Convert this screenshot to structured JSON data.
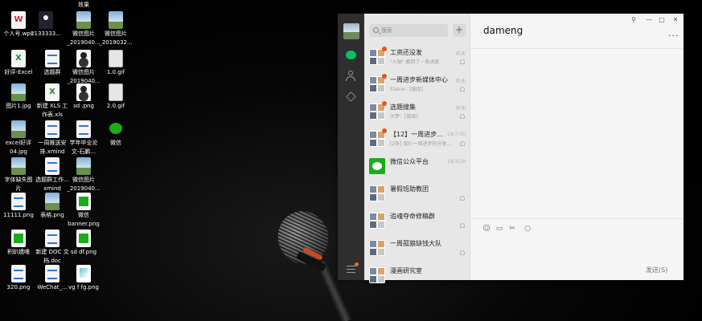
{
  "desktop": {
    "icons": [
      {
        "label": "个人号.wps"
      },
      {
        "label": "2133333..."
      },
      {
        "label": "效果"
      },
      {
        "label": "微信图片"
      },
      {
        "label": "_2019040..."
      },
      {
        "label": "微信图片"
      },
      {
        "label": "_2019032..."
      },
      {
        "label": "好评-Excel"
      },
      {
        "label": "选题群"
      },
      {
        "label": "微信图片"
      },
      {
        "label": "_2019040..."
      },
      {
        "label": "1.0.gif"
      },
      {
        "label": "图片1.jpg"
      },
      {
        "label": "新建 XLS 工"
      },
      {
        "label": "作表.xls"
      },
      {
        "label": "sd .png"
      },
      {
        "label": "2.0.gif"
      },
      {
        "label": "excel好评"
      },
      {
        "label": "04.jpg"
      },
      {
        "label": "一周推送安"
      },
      {
        "label": "排.xmind"
      },
      {
        "label": "学年毕业论"
      },
      {
        "label": "文-石鹏..."
      },
      {
        "label": "微信"
      },
      {
        "label": "字体缺失图"
      },
      {
        "label": "片"
      },
      {
        "label": "选题群工作..."
      },
      {
        "label": "xmind"
      },
      {
        "label": "微信图片"
      },
      {
        "label": "_2019040..."
      },
      {
        "label": "11111.png"
      },
      {
        "label": "表格.png"
      },
      {
        "label": "微信"
      },
      {
        "label": "banner.png"
      },
      {
        "label": "积趴嫱嗜"
      },
      {
        "label": "新建 DOC 文"
      },
      {
        "label": "档.doc"
      },
      {
        "label": "sd df.png"
      },
      {
        "label": "320.png"
      },
      {
        "label": "WeChat_..."
      },
      {
        "label": "vg f fg.png"
      }
    ]
  },
  "wechat": {
    "search": {
      "placeholder": "搜索"
    },
    "add_label": "+",
    "chats": [
      {
        "name": "工资还没发",
        "preview": "\"火锅\" 撤回了一条消息",
        "time": "昨天",
        "unread": true
      },
      {
        "name": "一周进步新媒体中心",
        "preview": "Elaine：[链接]",
        "time": "昨天",
        "unread": true
      },
      {
        "name": "选题搜集",
        "preview": "大梦：[链接]",
        "time": "昨天",
        "unread": true
      },
      {
        "name": "【12】一周进步...",
        "preview": "[2条] 我们一周进步的分享...",
        "time": "19/7/30",
        "unread": true
      },
      {
        "name": "微信公众平台",
        "preview": "",
        "time": "19/3/29",
        "unread": false,
        "official": true
      },
      {
        "name": "暑假班助教团",
        "preview": "",
        "time": "",
        "unread": false
      },
      {
        "name": "追魂夺命修稿群",
        "preview": "",
        "time": "",
        "unread": false
      },
      {
        "name": "一周孤狼缺钱大队",
        "preview": "",
        "time": "",
        "unread": false
      },
      {
        "name": "漫画研究室",
        "preview": "",
        "time": "",
        "unread": false
      }
    ],
    "chat": {
      "title": "dameng",
      "more_label": "...",
      "send_label": "发送(S)"
    },
    "window_buttons": {
      "pin": "⚲",
      "minimize": "—",
      "maximize": "□",
      "close": "✕"
    },
    "toolbar": {
      "emoji": "☺",
      "folder": "▭",
      "scissors": "✂",
      "chat": "○"
    }
  }
}
